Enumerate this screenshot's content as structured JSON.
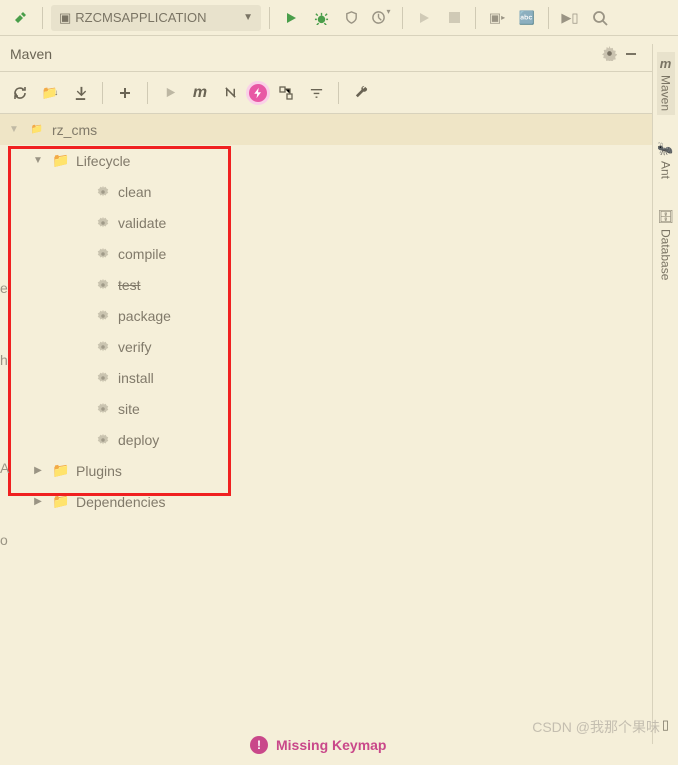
{
  "toolbar": {
    "run_config": "RZCMSAPPLICATION"
  },
  "panel": {
    "title": "Maven"
  },
  "tree": {
    "root": "rz_cms",
    "lifecycle": {
      "label": "Lifecycle",
      "goals": [
        "clean",
        "validate",
        "compile",
        "test",
        "package",
        "verify",
        "install",
        "site",
        "deploy"
      ],
      "struck_goals": [
        "test"
      ]
    },
    "plugins_label": "Plugins",
    "dependencies_label": "Dependencies"
  },
  "side_tabs": {
    "maven": "Maven",
    "ant": "Ant",
    "database": "Database"
  },
  "status": {
    "message": "Missing Keymap"
  },
  "watermark": "CSDN @我那个果味"
}
